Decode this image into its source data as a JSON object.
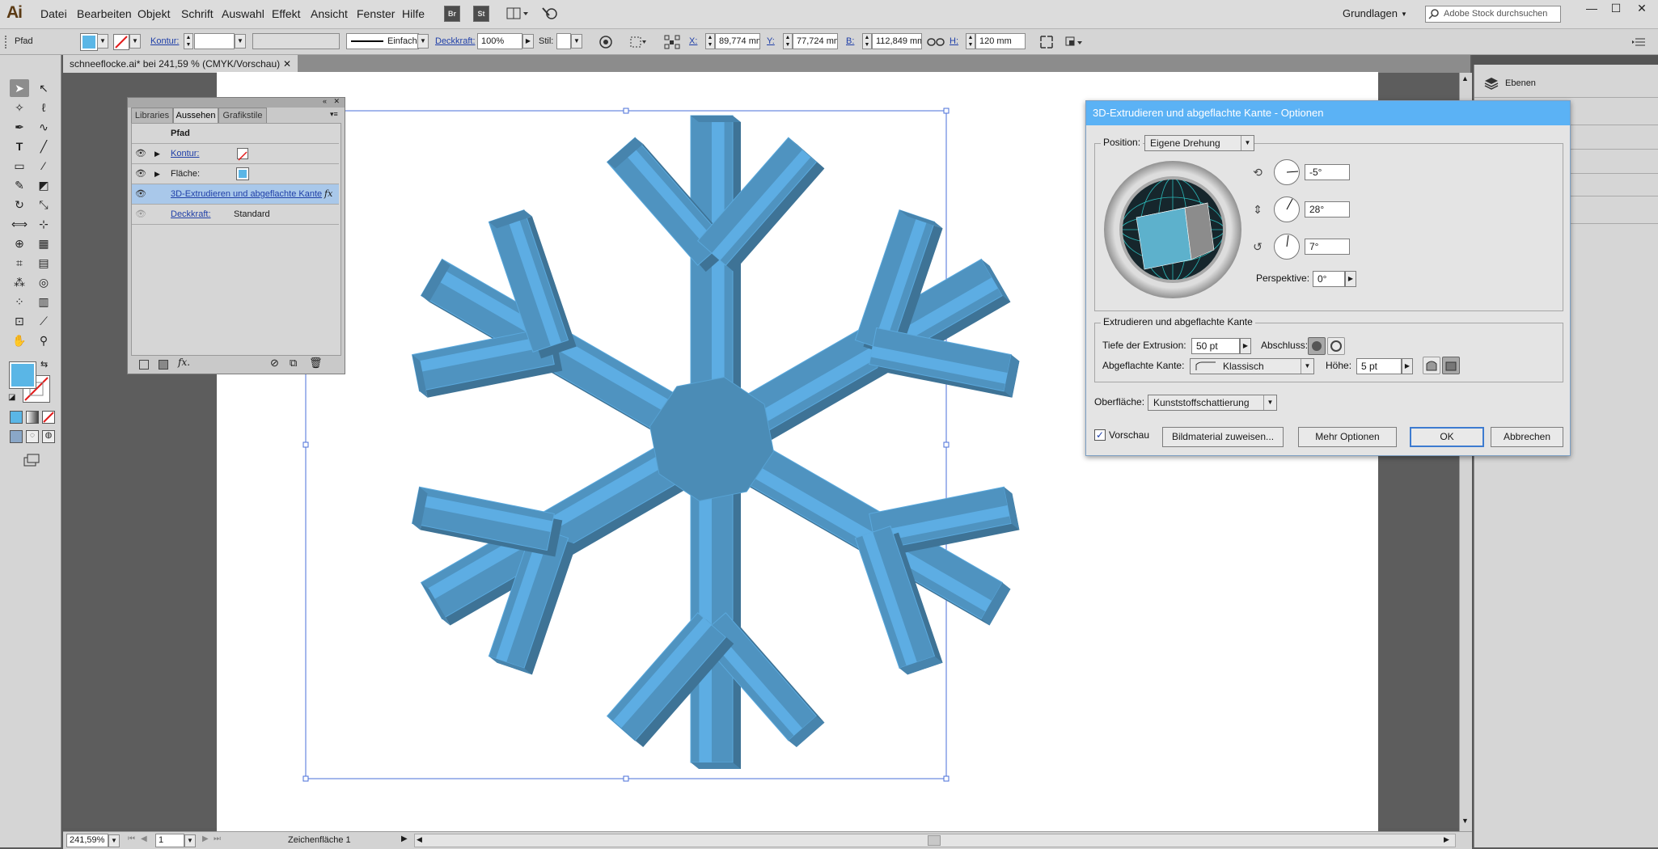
{
  "app": {
    "logo": "Ai"
  },
  "menu": [
    "Datei",
    "Bearbeiten",
    "Objekt",
    "Schrift",
    "Auswahl",
    "Effekt",
    "Ansicht",
    "Fenster",
    "Hilfe"
  ],
  "menubar_buttons": {
    "br": "Br",
    "st": "St"
  },
  "workspace": "Grundlagen",
  "search_placeholder": "Adobe Stock durchsuchen",
  "control": {
    "selection_type": "Pfad",
    "stroke_label": "Kontur:",
    "stroke_style": "Einfach",
    "opacity_label": "Deckkraft:",
    "opacity_value": "100%",
    "style_label": "Stil:",
    "x_label": "X:",
    "x_value": "89,774 mm",
    "y_label": "Y:",
    "y_value": "77,724 mm",
    "w_label": "B:",
    "w_value": "112,849 mm",
    "h_label": "H:",
    "h_value": "120 mm"
  },
  "document": {
    "tab_title": "schneeflocke.ai* bei 241,59 % (CMYK/Vorschau)",
    "zoom": "241,59%",
    "artboard_number": "1",
    "artboard_label": "Zeichenfläche 1"
  },
  "appearance": {
    "tabs": [
      "Libraries",
      "Aussehen",
      "Grafikstile"
    ],
    "header": "Pfad",
    "stroke_label": "Kontur:",
    "fill_label": "Fläche:",
    "effect_label": "3D-Extrudieren und abgeflachte Kante",
    "fx": "fx",
    "opacity_label": "Deckkraft:",
    "opacity_value": "Standard"
  },
  "dock": {
    "layers_label": "Ebenen"
  },
  "dialog": {
    "title": "3D-Extrudieren und abgeflachte Kante - Optionen",
    "position_label": "Position:",
    "position_value": "Eigene Drehung",
    "rot_x": "-5°",
    "rot_y": "28°",
    "rot_z": "7°",
    "perspective_label": "Perspektive:",
    "perspective_value": "0°",
    "extrude_group": "Extrudieren und abgeflachte Kante",
    "depth_label": "Tiefe der Extrusion:",
    "depth_value": "50 pt",
    "cap_label": "Abschluss:",
    "bevel_label": "Abgeflachte Kante:",
    "bevel_value": "Klassisch",
    "height_label": "Höhe:",
    "height_value": "5 pt",
    "surface_label": "Oberfläche:",
    "surface_value": "Kunststoffschattierung",
    "preview_label": "Vorschau",
    "map_art_button": "Bildmaterial zuweisen...",
    "more_options_button": "Mehr Optionen",
    "ok_button": "OK",
    "cancel_button": "Abbrechen"
  },
  "colors": {
    "fill": "#5ab6e6",
    "snowflake": "#4f93c0",
    "accent": "#5bb2f5",
    "link": "#1f3fa8"
  }
}
